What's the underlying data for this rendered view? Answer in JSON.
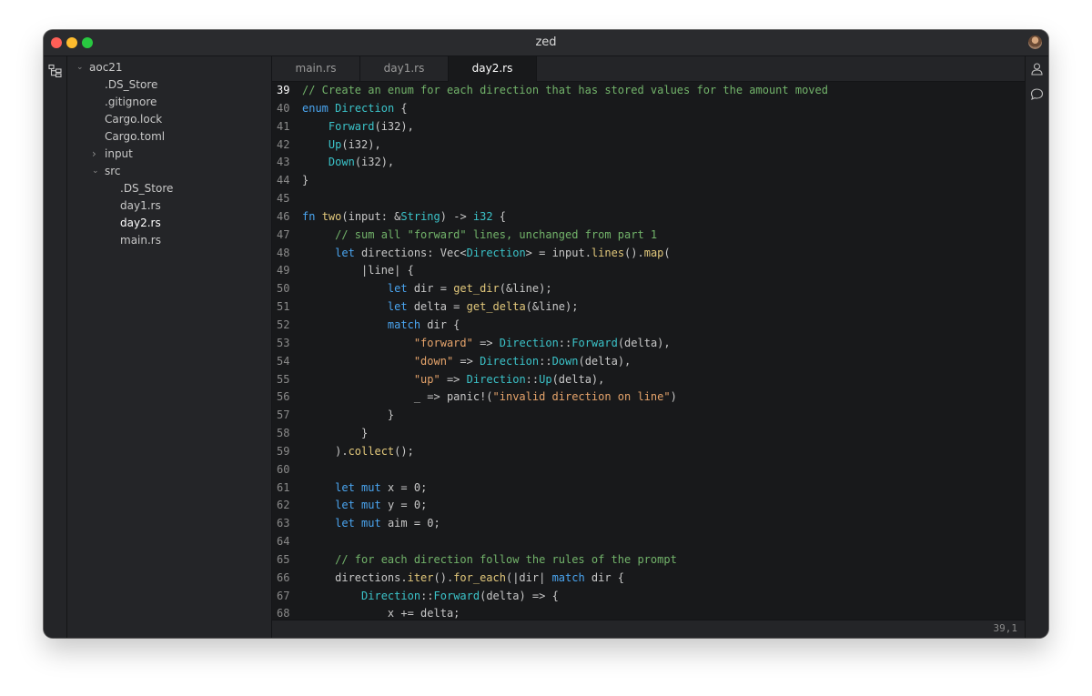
{
  "window": {
    "title": "zed"
  },
  "sidebar": {
    "tree": [
      {
        "name": "aoc21",
        "depth": 0,
        "folder": true,
        "expanded": true
      },
      {
        "name": ".DS_Store",
        "depth": 1,
        "folder": false
      },
      {
        "name": ".gitignore",
        "depth": 1,
        "folder": false
      },
      {
        "name": "Cargo.lock",
        "depth": 1,
        "folder": false
      },
      {
        "name": "Cargo.toml",
        "depth": 1,
        "folder": false
      },
      {
        "name": "input",
        "depth": 1,
        "folder": true,
        "expanded": false
      },
      {
        "name": "src",
        "depth": 1,
        "folder": true,
        "expanded": true
      },
      {
        "name": ".DS_Store",
        "depth": 2,
        "folder": false
      },
      {
        "name": "day1.rs",
        "depth": 2,
        "folder": false
      },
      {
        "name": "day2.rs",
        "depth": 2,
        "folder": false,
        "selected": true
      },
      {
        "name": "main.rs",
        "depth": 2,
        "folder": false
      }
    ]
  },
  "tabs": [
    {
      "label": "main.rs",
      "active": false
    },
    {
      "label": "day1.rs",
      "active": false
    },
    {
      "label": "day2.rs",
      "active": true
    }
  ],
  "editor": {
    "current_line": 39,
    "lines": [
      {
        "n": 39,
        "segs": [
          [
            "cm",
            "// Create an enum for each direction that has stored values for the amount moved"
          ]
        ]
      },
      {
        "n": 40,
        "segs": [
          [
            "kw",
            "enum"
          ],
          [
            "",
            " "
          ],
          [
            "ty",
            "Direction"
          ],
          [
            "",
            " {"
          ]
        ]
      },
      {
        "n": 41,
        "segs": [
          [
            "",
            "    "
          ],
          [
            "ty",
            "Forward"
          ],
          [
            "",
            "(i32),"
          ]
        ]
      },
      {
        "n": 42,
        "segs": [
          [
            "",
            "    "
          ],
          [
            "ty",
            "Up"
          ],
          [
            "",
            "(i32),"
          ]
        ]
      },
      {
        "n": 43,
        "segs": [
          [
            "",
            "    "
          ],
          [
            "ty",
            "Down"
          ],
          [
            "",
            "(i32),"
          ]
        ]
      },
      {
        "n": 44,
        "segs": [
          [
            "",
            "}"
          ]
        ]
      },
      {
        "n": 45,
        "segs": []
      },
      {
        "n": 46,
        "segs": [
          [
            "kw",
            "fn"
          ],
          [
            "",
            " "
          ],
          [
            "fn",
            "two"
          ],
          [
            "",
            "(input: &"
          ],
          [
            "ty",
            "String"
          ],
          [
            "",
            ") -> "
          ],
          [
            "ty",
            "i32"
          ],
          [
            "",
            " {"
          ]
        ]
      },
      {
        "n": 47,
        "segs": [
          [
            "",
            "     "
          ],
          [
            "cm",
            "// sum all \"forward\" lines, unchanged from part 1"
          ]
        ]
      },
      {
        "n": 48,
        "segs": [
          [
            "",
            "     "
          ],
          [
            "kw",
            "let"
          ],
          [
            "",
            " directions: Vec<"
          ],
          [
            "ty",
            "Direction"
          ],
          [
            "",
            "> = input."
          ],
          [
            "fn",
            "lines"
          ],
          [
            "",
            "()."
          ],
          [
            "fn",
            "map"
          ],
          [
            "",
            "("
          ]
        ]
      },
      {
        "n": 49,
        "segs": [
          [
            "",
            "         |line| {"
          ]
        ]
      },
      {
        "n": 50,
        "segs": [
          [
            "",
            "             "
          ],
          [
            "kw",
            "let"
          ],
          [
            "",
            " dir = "
          ],
          [
            "fn",
            "get_dir"
          ],
          [
            "",
            "(&line);"
          ]
        ]
      },
      {
        "n": 51,
        "segs": [
          [
            "",
            "             "
          ],
          [
            "kw",
            "let"
          ],
          [
            "",
            " delta = "
          ],
          [
            "fn",
            "get_delta"
          ],
          [
            "",
            "(&line);"
          ]
        ]
      },
      {
        "n": 52,
        "segs": [
          [
            "",
            "             "
          ],
          [
            "kw",
            "match"
          ],
          [
            "",
            " dir {"
          ]
        ]
      },
      {
        "n": 53,
        "segs": [
          [
            "",
            "                 "
          ],
          [
            "str",
            "\"forward\""
          ],
          [
            "",
            " => "
          ],
          [
            "ty",
            "Direction"
          ],
          [
            "",
            "::"
          ],
          [
            "ty",
            "Forward"
          ],
          [
            "",
            "(delta),"
          ]
        ]
      },
      {
        "n": 54,
        "segs": [
          [
            "",
            "                 "
          ],
          [
            "str",
            "\"down\""
          ],
          [
            "",
            " => "
          ],
          [
            "ty",
            "Direction"
          ],
          [
            "",
            "::"
          ],
          [
            "ty",
            "Down"
          ],
          [
            "",
            "(delta),"
          ]
        ]
      },
      {
        "n": 55,
        "segs": [
          [
            "",
            "                 "
          ],
          [
            "str",
            "\"up\""
          ],
          [
            "",
            " => "
          ],
          [
            "ty",
            "Direction"
          ],
          [
            "",
            "::"
          ],
          [
            "ty",
            "Up"
          ],
          [
            "",
            "(delta),"
          ]
        ]
      },
      {
        "n": 56,
        "segs": [
          [
            "",
            "                 _ => panic!("
          ],
          [
            "str",
            "\"invalid direction on line\""
          ],
          [
            "",
            ")"
          ]
        ]
      },
      {
        "n": 57,
        "segs": [
          [
            "",
            "             }"
          ]
        ]
      },
      {
        "n": 58,
        "segs": [
          [
            "",
            "         }"
          ]
        ]
      },
      {
        "n": 59,
        "segs": [
          [
            "",
            "     )."
          ],
          [
            "fn",
            "collect"
          ],
          [
            "",
            "();"
          ]
        ]
      },
      {
        "n": 60,
        "segs": []
      },
      {
        "n": 61,
        "segs": [
          [
            "",
            "     "
          ],
          [
            "kw",
            "let"
          ],
          [
            "",
            " "
          ],
          [
            "kw",
            "mut"
          ],
          [
            "",
            " x = 0;"
          ]
        ]
      },
      {
        "n": 62,
        "segs": [
          [
            "",
            "     "
          ],
          [
            "kw",
            "let"
          ],
          [
            "",
            " "
          ],
          [
            "kw",
            "mut"
          ],
          [
            "",
            " y = 0;"
          ]
        ]
      },
      {
        "n": 63,
        "segs": [
          [
            "",
            "     "
          ],
          [
            "kw",
            "let"
          ],
          [
            "",
            " "
          ],
          [
            "kw",
            "mut"
          ],
          [
            "",
            " aim = 0;"
          ]
        ]
      },
      {
        "n": 64,
        "segs": []
      },
      {
        "n": 65,
        "segs": [
          [
            "",
            "     "
          ],
          [
            "cm",
            "// for each direction follow the rules of the prompt"
          ]
        ]
      },
      {
        "n": 66,
        "segs": [
          [
            "",
            "     directions."
          ],
          [
            "fn",
            "iter"
          ],
          [
            "",
            "()."
          ],
          [
            "fn",
            "for_each"
          ],
          [
            "",
            "(|dir| "
          ],
          [
            "kw",
            "match"
          ],
          [
            "",
            " dir {"
          ]
        ]
      },
      {
        "n": 67,
        "segs": [
          [
            "",
            "         "
          ],
          [
            "ty",
            "Direction"
          ],
          [
            "",
            "::"
          ],
          [
            "ty",
            "Forward"
          ],
          [
            "",
            "(delta) => {"
          ]
        ]
      },
      {
        "n": 68,
        "segs": [
          [
            "",
            "             x += delta;"
          ]
        ]
      }
    ]
  },
  "status": {
    "cursor": "39,1"
  },
  "icons": {
    "left_activity": "project-tree-icon",
    "right_activity": [
      "user-icon",
      "chat-bubble-icon"
    ]
  }
}
